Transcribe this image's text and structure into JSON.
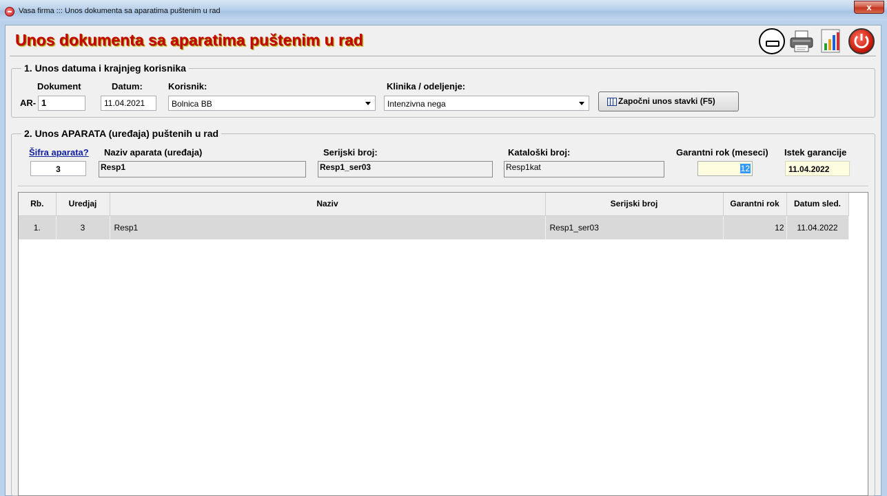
{
  "window": {
    "title": "Vasa firma ::: Unos dokumenta sa aparatima puštenim u rad",
    "close_label": "x"
  },
  "header": {
    "title": "Unos dokumenta sa aparatima puštenim u rad"
  },
  "section1": {
    "legend": "1. Unos datuma i krajnjeg korisnika",
    "dokument_label": "Dokument",
    "dokument_prefix": "AR-",
    "dokument_value": "1",
    "datum_label": "Datum:",
    "datum_value": "11.04.2021",
    "korisnik_label": "Korisnik:",
    "korisnik_value": "Bolnica BB",
    "klinika_label": "Klinika / odeljenje:",
    "klinika_value": "Intenzivna nega",
    "start_button": "Započni unos stavki (F5)"
  },
  "section2": {
    "legend": "2. Unos APARATA (uređaja) puštenih u rad",
    "sifra_link": "Šifra aparata?",
    "sifra_value": "3",
    "naziv_label": "Naziv aparata (uređaja)",
    "naziv_value": "Resp1",
    "serijski_label": "Serijski broj:",
    "serijski_value": "Resp1_ser03",
    "katalosko_label": "Kataloški broj:",
    "katalosko_value": "Resp1kat",
    "garantni_label": "Garantni rok (meseci)",
    "garantni_value": "12",
    "istek_label": "Istek garancije",
    "istek_value": "11.04.2022"
  },
  "table": {
    "columns": [
      "Rb.",
      "Uredjaj",
      "Naziv",
      "Serijski broj",
      "Garantni rok",
      "Datum sled."
    ],
    "rows": [
      [
        "1.",
        "3",
        "Resp1",
        "Resp1_ser03",
        "12",
        "11.04.2022"
      ]
    ]
  }
}
